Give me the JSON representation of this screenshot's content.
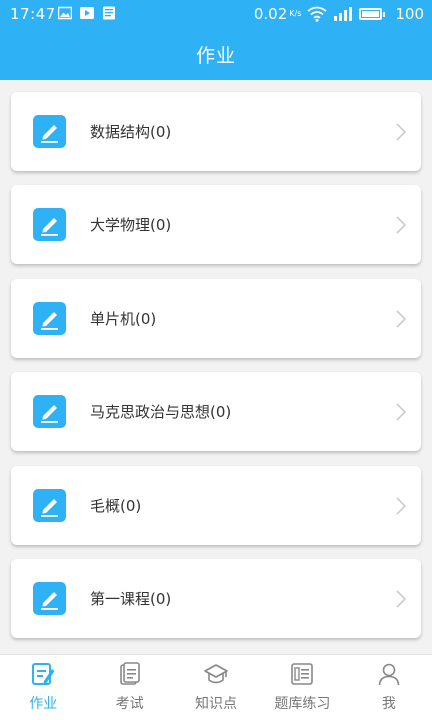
{
  "status_bar": {
    "time": "17:47",
    "net_speed": "0.02",
    "net_unit": "K/s",
    "battery_level": "100"
  },
  "header": {
    "title": "作业"
  },
  "courses": [
    {
      "label": "数据结构(0)"
    },
    {
      "label": "大学物理(0)"
    },
    {
      "label": "单片机(0)"
    },
    {
      "label": "马克思政治与思想(0)"
    },
    {
      "label": "毛概(0)"
    },
    {
      "label": "第一课程(0)"
    }
  ],
  "tabs": [
    {
      "label": "作业",
      "icon": "homework-icon",
      "active": true
    },
    {
      "label": "考试",
      "icon": "exam-icon",
      "active": false
    },
    {
      "label": "知识点",
      "icon": "graduation-cap-icon",
      "active": false
    },
    {
      "label": "题库练习",
      "icon": "question-bank-icon",
      "active": false
    },
    {
      "label": "我",
      "icon": "user-icon",
      "active": false
    }
  ],
  "colors": {
    "primary": "#2fb1f6",
    "background": "#f2f2f2",
    "card": "#ffffff",
    "text": "#333333",
    "tab_inactive": "#777777"
  }
}
